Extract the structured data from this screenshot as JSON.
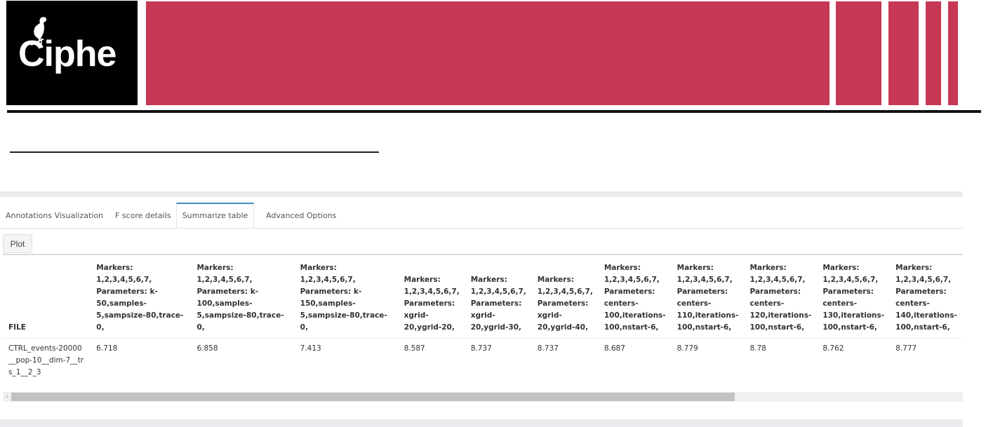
{
  "header": {
    "logo_text": "Ciphe",
    "accent_color": "#c63854"
  },
  "tabs": [
    {
      "label": "Annotations Visualization"
    },
    {
      "label": "F score details"
    },
    {
      "label": "Summarize table"
    },
    {
      "label": "Advanced Options"
    }
  ],
  "active_tab": "Summarize table",
  "plot_button": {
    "label": "Plot"
  },
  "table": {
    "columns": [
      "FILE",
      "Markers: 1,2,3,4,5,6,7, Parameters: k-50,samples-5,sampsize-80,trace-0,",
      "Markers: 1,2,3,4,5,6,7, Parameters: k-100,samples-5,sampsize-80,trace-0,",
      "Markers: 1,2,3,4,5,6,7, Parameters: k-150,samples-5,sampsize-80,trace-0,",
      "Markers: 1,2,3,4,5,6,7, Parameters: xgrid-20,ygrid-20,",
      "Markers: 1,2,3,4,5,6,7, Parameters: xgrid-20,ygrid-30,",
      "Markers: 1,2,3,4,5,6,7, Parameters: xgrid-20,ygrid-40,",
      "Markers: 1,2,3,4,5,6,7, Parameters: centers-100,iterations-100,nstart-6,",
      "Markers: 1,2,3,4,5,6,7, Parameters: centers-110,iterations-100,nstart-6,",
      "Markers: 1,2,3,4,5,6,7, Parameters: centers-120,iterations-100,nstart-6,",
      "Markers: 1,2,3,4,5,6,7, Parameters: centers-130,iterations-100,nstart-6,",
      "Markers: 1,2,3,4,5,6,7, Parameters: centers-140,iterations-100,nstart-6,"
    ],
    "rows": [
      [
        "CTRL_events-20000__pop-10__dim-7__trs_1__2_3",
        "6.718",
        "6.858",
        "7.413",
        "8.587",
        "8.737",
        "8.737",
        "8.687",
        "8.779",
        "8.78",
        "8.762",
        "8.777"
      ]
    ]
  },
  "scrollbar": {
    "left_arrow": "‹"
  }
}
